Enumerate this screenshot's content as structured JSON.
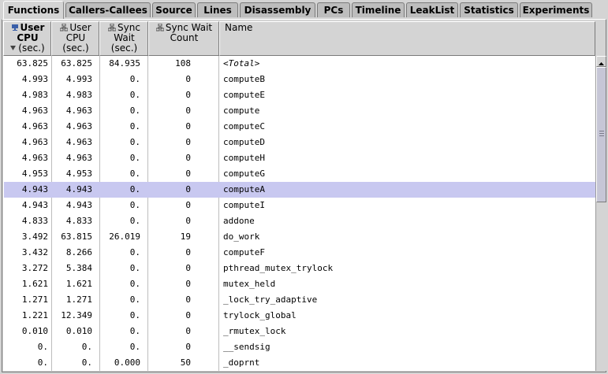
{
  "tabs": [
    {
      "label": "Functions",
      "active": true
    },
    {
      "label": "Callers-Callees",
      "active": false
    },
    {
      "label": "Source",
      "active": false
    },
    {
      "label": "Lines",
      "active": false
    },
    {
      "label": "Disassembly",
      "active": false
    },
    {
      "label": "PCs",
      "active": false
    },
    {
      "label": "Timeline",
      "active": false
    },
    {
      "label": "LeakList",
      "active": false
    },
    {
      "label": "Statistics",
      "active": false
    },
    {
      "label": "Experiments",
      "active": false
    }
  ],
  "columns": {
    "excl_user_cpu": {
      "line1": "User",
      "line2": "CPU",
      "line3": "(sec.)"
    },
    "incl_user_cpu": {
      "line1": "User",
      "line2": "CPU",
      "line3": "(sec.)"
    },
    "incl_sync_wait": {
      "line1": "Sync",
      "line2": "Wait",
      "line3": "(sec.)"
    },
    "incl_sync_count": {
      "line1": "Sync Wait",
      "line2": "Count"
    },
    "name": {
      "line1": "Name"
    }
  },
  "rows": [
    {
      "excl": "63.825",
      "incl": "63.825",
      "wait": "84.935",
      "count": "108",
      "name": "<Total>"
    },
    {
      "excl": "4.993",
      "incl": "4.993",
      "wait": "0.",
      "count": "0",
      "name": "computeB"
    },
    {
      "excl": "4.983",
      "incl": "4.983",
      "wait": "0.",
      "count": "0",
      "name": "computeE"
    },
    {
      "excl": "4.963",
      "incl": "4.963",
      "wait": "0.",
      "count": "0",
      "name": "compute"
    },
    {
      "excl": "4.963",
      "incl": "4.963",
      "wait": "0.",
      "count": "0",
      "name": "computeC"
    },
    {
      "excl": "4.963",
      "incl": "4.963",
      "wait": "0.",
      "count": "0",
      "name": "computeD"
    },
    {
      "excl": "4.963",
      "incl": "4.963",
      "wait": "0.",
      "count": "0",
      "name": "computeH"
    },
    {
      "excl": "4.953",
      "incl": "4.953",
      "wait": "0.",
      "count": "0",
      "name": "computeG"
    },
    {
      "excl": "4.943",
      "incl": "4.943",
      "wait": "0.",
      "count": "0",
      "name": "computeA",
      "selected": true
    },
    {
      "excl": "4.943",
      "incl": "4.943",
      "wait": "0.",
      "count": "0",
      "name": "computeI"
    },
    {
      "excl": "4.833",
      "incl": "4.833",
      "wait": "0.",
      "count": "0",
      "name": "addone"
    },
    {
      "excl": "3.492",
      "incl": "63.815",
      "wait": "26.019",
      "count": "19",
      "name": "do_work"
    },
    {
      "excl": "3.432",
      "incl": "8.266",
      "wait": "0.",
      "count": "0",
      "name": "computeF"
    },
    {
      "excl": "3.272",
      "incl": "5.384",
      "wait": "0.",
      "count": "0",
      "name": "pthread_mutex_trylock"
    },
    {
      "excl": "1.621",
      "incl": "1.621",
      "wait": "0.",
      "count": "0",
      "name": "mutex_held"
    },
    {
      "excl": "1.271",
      "incl": "1.271",
      "wait": "0.",
      "count": "0",
      "name": "_lock_try_adaptive"
    },
    {
      "excl": "1.221",
      "incl": "12.349",
      "wait": "0.",
      "count": "0",
      "name": "trylock_global"
    },
    {
      "excl": "0.010",
      "incl": "0.010",
      "wait": "0.",
      "count": "0",
      "name": "_rmutex_lock"
    },
    {
      "excl": "0.",
      "incl": "0.",
      "wait": "0.",
      "count": "0",
      "name": "__sendsig"
    },
    {
      "excl": "0.",
      "incl": "0.",
      "wait": "0.000",
      "count": "50",
      "name": "_doprnt"
    }
  ],
  "colors": {
    "selected_row": "#c8c8f0",
    "background": "#d4d4d4"
  }
}
